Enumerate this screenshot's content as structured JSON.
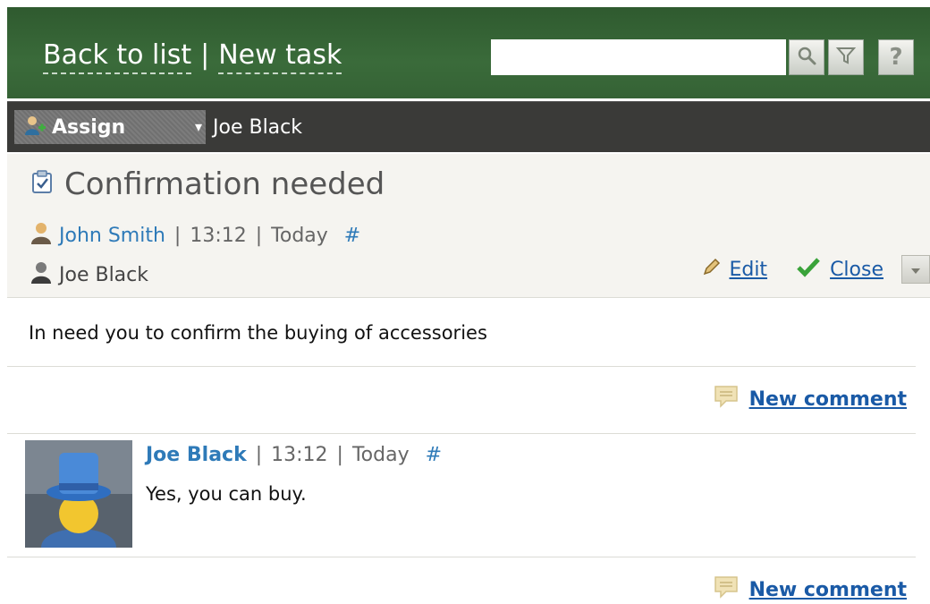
{
  "header": {
    "back_link": "Back to list",
    "separator": "|",
    "new_task_link": "New task",
    "search": {
      "value": "",
      "placeholder": ""
    },
    "search_button_icon": "search-icon",
    "filter_button_icon": "filter-icon",
    "help_button_label": "?"
  },
  "toolbar": {
    "assign_label": "Assign",
    "assign_icon": "add-user-icon",
    "assignee": "Joe Black"
  },
  "task": {
    "title": "Confirmation needed",
    "title_icon": "task-checkbox-icon",
    "author": "John Smith",
    "time": "13:12",
    "date": "Today",
    "permalink": "#",
    "responsible": "Joe Black",
    "edit_label": "Edit",
    "close_label": "Close",
    "description": "In need you to confirm the buying of accessories"
  },
  "new_comment_label": "New comment",
  "comments": [
    {
      "author": "Joe Black",
      "time": "13:12",
      "date": "Today",
      "permalink": "#",
      "text": "Yes, you can buy."
    }
  ],
  "colors": {
    "header_bg": "#3a6b3a",
    "toolbar_bg": "#3a3a38",
    "link": "#2e7ab8",
    "task_bg": "#f5f4f0"
  }
}
